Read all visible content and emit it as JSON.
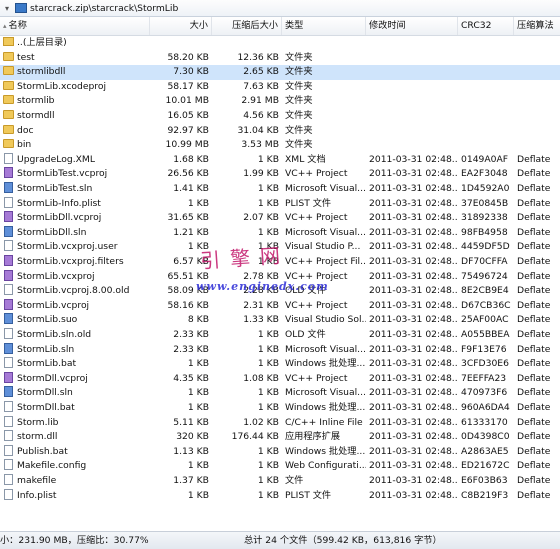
{
  "address_bar": {
    "path": "starcrack.zip\\starcrack\\StormLib"
  },
  "columns": {
    "name": "名称",
    "size": "大小",
    "packed_size": "压缩后大小",
    "type": "类型",
    "modified": "修改时间",
    "crc": "CRC32",
    "algorithm": "压缩算法"
  },
  "parent_row": {
    "name": "..(上层目录)"
  },
  "rows": [
    {
      "name": "test",
      "size": "58.20 KB",
      "packed": "12.36 KB",
      "type": "文件夹",
      "modified": "",
      "crc": "",
      "algo": "",
      "kind": "folder"
    },
    {
      "name": "stormlibdll",
      "size": "7.30 KB",
      "packed": "2.65 KB",
      "type": "文件夹",
      "modified": "",
      "crc": "",
      "algo": "",
      "kind": "folder"
    },
    {
      "name": "StormLib.xcodeproj",
      "size": "58.17 KB",
      "packed": "7.63 KB",
      "type": "文件夹",
      "modified": "",
      "crc": "",
      "algo": "",
      "kind": "folder"
    },
    {
      "name": "stormlib",
      "size": "10.01 MB",
      "packed": "2.91 MB",
      "type": "文件夹",
      "modified": "",
      "crc": "",
      "algo": "",
      "kind": "folder"
    },
    {
      "name": "stormdll",
      "size": "16.05 KB",
      "packed": "4.56 KB",
      "type": "文件夹",
      "modified": "",
      "crc": "",
      "algo": "",
      "kind": "folder"
    },
    {
      "name": "doc",
      "size": "92.97 KB",
      "packed": "31.04 KB",
      "type": "文件夹",
      "modified": "",
      "crc": "",
      "algo": "",
      "kind": "folder"
    },
    {
      "name": "bin",
      "size": "10.99 MB",
      "packed": "3.53 MB",
      "type": "文件夹",
      "modified": "",
      "crc": "",
      "algo": "",
      "kind": "folder"
    },
    {
      "name": "UpgradeLog.XML",
      "size": "1.68 KB",
      "packed": "1 KB",
      "type": "XML 文档",
      "modified": "2011-03-31 02:48...",
      "crc": "0149A0AF",
      "algo": "Deflate",
      "kind": "file"
    },
    {
      "name": "StormLibTest.vcproj",
      "size": "26.56 KB",
      "packed": "1.99 KB",
      "type": "VC++ Project",
      "modified": "2011-03-31 02:48...",
      "crc": "EA2F3048",
      "algo": "Deflate",
      "kind": "vs"
    },
    {
      "name": "StormLibTest.sln",
      "size": "1.41 KB",
      "packed": "1 KB",
      "type": "Microsoft Visual...",
      "modified": "2011-03-31 02:48...",
      "crc": "1D4592A0",
      "algo": "Deflate",
      "kind": "blue"
    },
    {
      "name": "StormLib-Info.plist",
      "size": "1 KB",
      "packed": "1 KB",
      "type": "PLIST 文件",
      "modified": "2011-03-31 02:48...",
      "crc": "37E0845B",
      "algo": "Deflate",
      "kind": "file"
    },
    {
      "name": "StormLibDll.vcproj",
      "size": "31.65 KB",
      "packed": "2.07 KB",
      "type": "VC++ Project",
      "modified": "2011-03-31 02:48...",
      "crc": "31892338",
      "algo": "Deflate",
      "kind": "vs"
    },
    {
      "name": "StormLibDll.sln",
      "size": "1.21 KB",
      "packed": "1 KB",
      "type": "Microsoft Visual...",
      "modified": "2011-03-31 02:48...",
      "crc": "98FB4958",
      "algo": "Deflate",
      "kind": "blue"
    },
    {
      "name": "StormLib.vcxproj.user",
      "size": "1 KB",
      "packed": "1 KB",
      "type": "Visual Studio P...",
      "modified": "2011-03-31 02:48...",
      "crc": "4459DF5D",
      "algo": "Deflate",
      "kind": "file"
    },
    {
      "name": "StormLib.vcxproj.filters",
      "size": "6.57 KB",
      "packed": "1 KB",
      "type": "VC++ Project Fil...",
      "modified": "2011-03-31 02:48...",
      "crc": "DF70CFFA",
      "algo": "Deflate",
      "kind": "vs"
    },
    {
      "name": "StormLib.vcxproj",
      "size": "65.51 KB",
      "packed": "2.78 KB",
      "type": "VC++ Project",
      "modified": "2011-03-31 02:48...",
      "crc": "75496724",
      "algo": "Deflate",
      "kind": "vs"
    },
    {
      "name": "StormLib.vcproj.8.00.old",
      "size": "58.09 KB",
      "packed": "2.28 KB",
      "type": "OLD 文件",
      "modified": "2011-03-31 02:48...",
      "crc": "8E2CB9E4",
      "algo": "Deflate",
      "kind": "file"
    },
    {
      "name": "StormLib.vcproj",
      "size": "58.16 KB",
      "packed": "2.31 KB",
      "type": "VC++ Project",
      "modified": "2011-03-31 02:48...",
      "crc": "D67CB36C",
      "algo": "Deflate",
      "kind": "vs"
    },
    {
      "name": "StormLib.suo",
      "size": "8 KB",
      "packed": "1.33 KB",
      "type": "Visual Studio Sol...",
      "modified": "2011-03-31 02:48...",
      "crc": "25AF00AC",
      "algo": "Deflate",
      "kind": "blue"
    },
    {
      "name": "StormLib.sln.old",
      "size": "2.33 KB",
      "packed": "1 KB",
      "type": "OLD 文件",
      "modified": "2011-03-31 02:48...",
      "crc": "A055BBEA",
      "algo": "Deflate",
      "kind": "file"
    },
    {
      "name": "StormLib.sln",
      "size": "2.33 KB",
      "packed": "1 KB",
      "type": "Microsoft Visual...",
      "modified": "2011-03-31 02:48...",
      "crc": "F9F13E76",
      "algo": "Deflate",
      "kind": "blue"
    },
    {
      "name": "StormLib.bat",
      "size": "1 KB",
      "packed": "1 KB",
      "type": "Windows 批处理...",
      "modified": "2011-03-31 02:48...",
      "crc": "3CFD30E6",
      "algo": "Deflate",
      "kind": "file"
    },
    {
      "name": "StormDll.vcproj",
      "size": "4.35 KB",
      "packed": "1.08 KB",
      "type": "VC++ Project",
      "modified": "2011-03-31 02:48...",
      "crc": "7EEFFA23",
      "algo": "Deflate",
      "kind": "vs"
    },
    {
      "name": "StormDll.sln",
      "size": "1 KB",
      "packed": "1 KB",
      "type": "Microsoft Visual...",
      "modified": "2011-03-31 02:48...",
      "crc": "470973F6",
      "algo": "Deflate",
      "kind": "blue"
    },
    {
      "name": "StormDll.bat",
      "size": "1 KB",
      "packed": "1 KB",
      "type": "Windows 批处理...",
      "modified": "2011-03-31 02:48...",
      "crc": "960A6DA4",
      "algo": "Deflate",
      "kind": "file"
    },
    {
      "name": "Storm.lib",
      "size": "5.11 KB",
      "packed": "1.02 KB",
      "type": "C/C++ Inline File",
      "modified": "2011-03-31 02:48...",
      "crc": "61333170",
      "algo": "Deflate",
      "kind": "file"
    },
    {
      "name": "storm.dll",
      "size": "320 KB",
      "packed": "176.44 KB",
      "type": "应用程序扩展",
      "modified": "2011-03-31 02:48...",
      "crc": "0D4398C0",
      "algo": "Deflate",
      "kind": "file"
    },
    {
      "name": "Publish.bat",
      "size": "1.13 KB",
      "packed": "1 KB",
      "type": "Windows 批处理...",
      "modified": "2011-03-31 02:48...",
      "crc": "A2863AE5",
      "algo": "Deflate",
      "kind": "file"
    },
    {
      "name": "Makefile.config",
      "size": "1 KB",
      "packed": "1 KB",
      "type": "Web Configurati...",
      "modified": "2011-03-31 02:48...",
      "crc": "ED21672C",
      "algo": "Deflate",
      "kind": "file"
    },
    {
      "name": "makefile",
      "size": "1.37 KB",
      "packed": "1 KB",
      "type": "文件",
      "modified": "2011-03-31 02:48...",
      "crc": "E6F03B63",
      "algo": "Deflate",
      "kind": "file"
    },
    {
      "name": "Info.plist",
      "size": "1 KB",
      "packed": "1 KB",
      "type": "PLIST 文件",
      "modified": "2011-03-31 02:48...",
      "crc": "C8B219F3",
      "algo": "Deflate",
      "kind": "file"
    }
  ],
  "selected_index": 1,
  "status": {
    "left": "小：231.90 MB，压缩比：30.77%",
    "right": "总计 24 个文件（599.42 KB，613,816 字节）"
  },
  "watermark": {
    "line1": "引擎网",
    "line2": "www.enginedx.com"
  },
  "colors": {
    "selection": "#cfe4fb",
    "folder": "#f0c95a",
    "watermark1": "#c2176b",
    "watermark2": "#2b2bd6"
  }
}
